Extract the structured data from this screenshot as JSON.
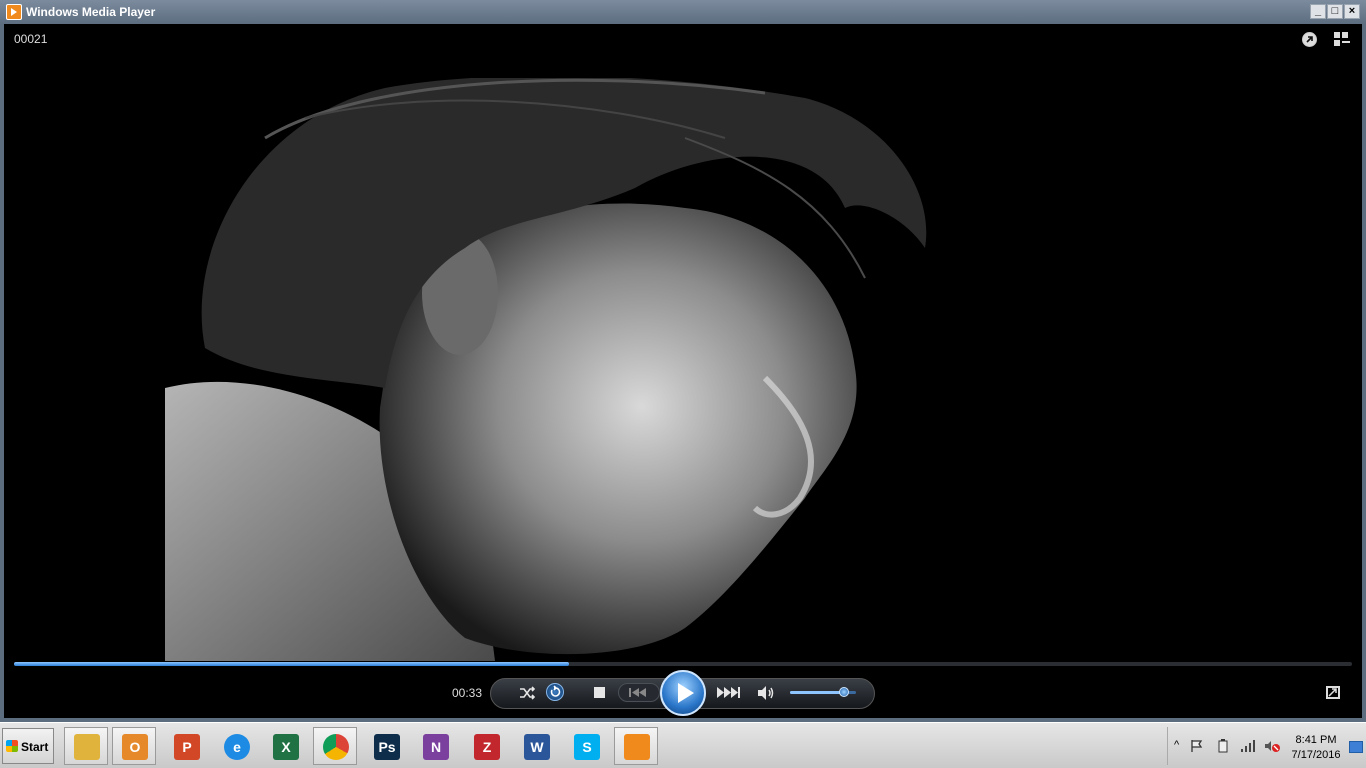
{
  "window": {
    "title": "Windows Media Player",
    "min": "_",
    "max": "□",
    "close": "×"
  },
  "player": {
    "file_label": "00021",
    "elapsed": "00:33",
    "progress_fraction": 0.415,
    "volume_fraction": 0.82
  },
  "icons": {
    "app": "windows-media-player-icon",
    "top_right": [
      "rate-icon",
      "switch-to-library-icon"
    ],
    "controls": [
      "shuffle-icon",
      "repeat-icon",
      "stop-icon",
      "previous-icon",
      "play-icon",
      "next-icon",
      "volume-icon",
      "switch-to-full-screen-icon"
    ]
  },
  "taskbar": {
    "start_label": "Start",
    "apps": [
      {
        "name": "explorer",
        "glyph": "",
        "color": "#e0b43c"
      },
      {
        "name": "outlook",
        "glyph": "O",
        "color": "#e5892a"
      },
      {
        "name": "powerpoint",
        "glyph": "P",
        "color": "#d24726"
      },
      {
        "name": "internet-explorer",
        "glyph": "e",
        "color": "#1d8be3"
      },
      {
        "name": "excel",
        "glyph": "X",
        "color": "#207245"
      },
      {
        "name": "chrome",
        "glyph": "",
        "color": "#db4437"
      },
      {
        "name": "photoshop",
        "glyph": "Ps",
        "color": "#0d2d4a"
      },
      {
        "name": "onenote",
        "glyph": "N",
        "color": "#7b3f9e"
      },
      {
        "name": "filezilla",
        "glyph": "Z",
        "color": "#c1272d"
      },
      {
        "name": "word",
        "glyph": "W",
        "color": "#2b579a"
      },
      {
        "name": "skype",
        "glyph": "S",
        "color": "#00aff0"
      },
      {
        "name": "media-player",
        "glyph": "",
        "color": "#f08a1c"
      }
    ],
    "clock_time": "8:41 PM",
    "clock_date": "7/17/2016"
  }
}
